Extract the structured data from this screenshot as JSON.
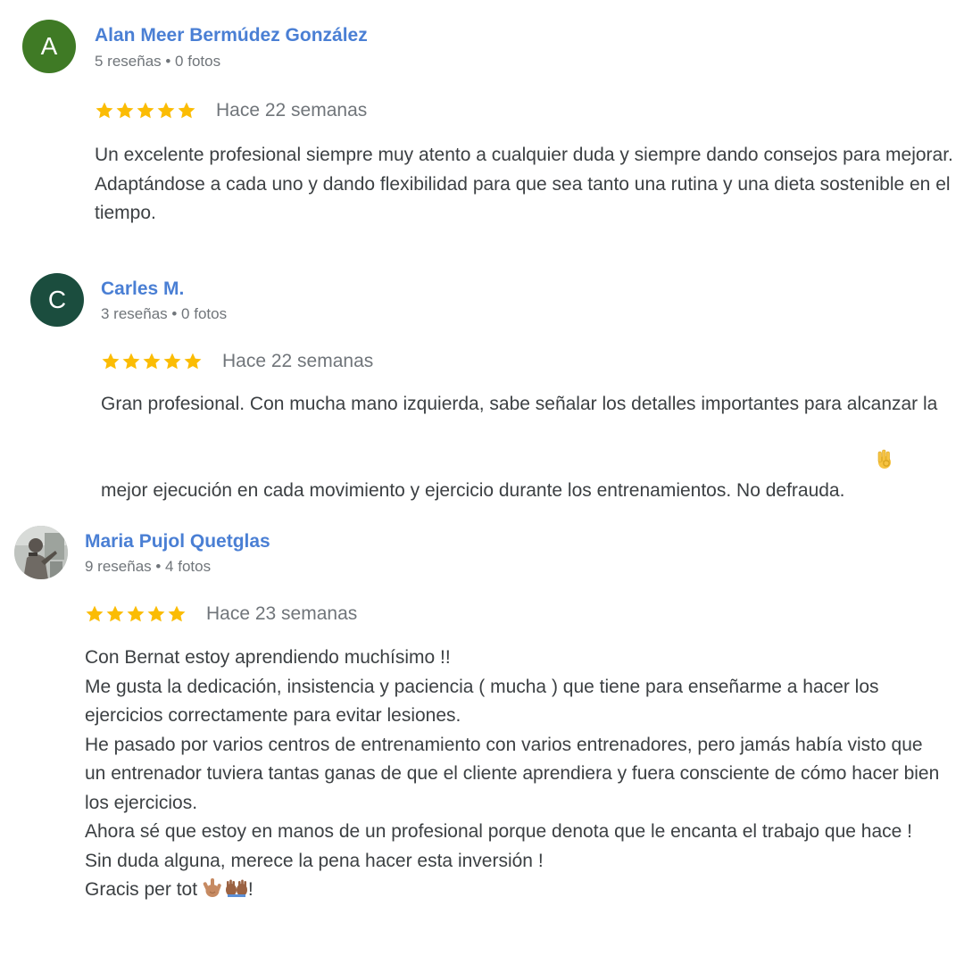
{
  "colors": {
    "link": "#4a7fd4",
    "star": "#fbbc04",
    "meta": "#70757a",
    "text": "#3c4043",
    "avatar_a": "#3f7a25",
    "avatar_c": "#1b4d3e"
  },
  "reviews": [
    {
      "avatar_letter": "A",
      "name": "Alan Meer Bermúdez González",
      "meta": "5 reseñas • 0 fotos",
      "rating": 5,
      "date": "Hace 22 semanas",
      "text": "Un excelente profesional siempre muy atento a cualquier duda y siempre dando consejos para mejorar. Adaptándose a cada uno y dando flexibilidad para que sea tanto una rutina y una dieta sostenible en el tiempo."
    },
    {
      "avatar_letter": "C",
      "name": "Carles M.",
      "meta": "3 reseñas • 0 fotos",
      "rating": 5,
      "date": "Hace 22 semanas",
      "text": "Gran profesional. Con mucha mano izquierda, sabe señalar los detalles importantes para alcanzar la mejor ejecución en cada movimiento y ejercicio durante los entrenamientos. No defrauda.",
      "trailing_emoji": "ok-hand-icon"
    },
    {
      "avatar_letter": "",
      "avatar_icon": "profile-photo",
      "name": "Maria Pujol Quetglas",
      "meta": "9 reseñas • 4 fotos",
      "rating": 5,
      "date": "Hace 23 semanas",
      "text_lines": [
        "Con Bernat estoy aprendiendo muchísimo !!",
        "Me gusta la dedicación, insistencia y paciencia ( mucha ) que tiene para enseñarme a hacer los ejercicios correctamente para evitar lesiones.",
        "He pasado por varios centros de entrenamiento con varios entrenadores, pero jamás había visto que un entrenador tuviera tantas ganas de que el cliente aprendiera y fuera consciente de cómo hacer bien los ejercicios.",
        "Ahora sé que estoy en manos de un profesional porque denota que le encanta el trabajo que hace !",
        "Sin duda alguna, merece la pena hacer esta inversión !",
        "Gracis per tot"
      ],
      "trailing_emojis": [
        "love-you-gesture-icon",
        "raising-hands-icon"
      ],
      "trailing_text": "!"
    }
  ]
}
